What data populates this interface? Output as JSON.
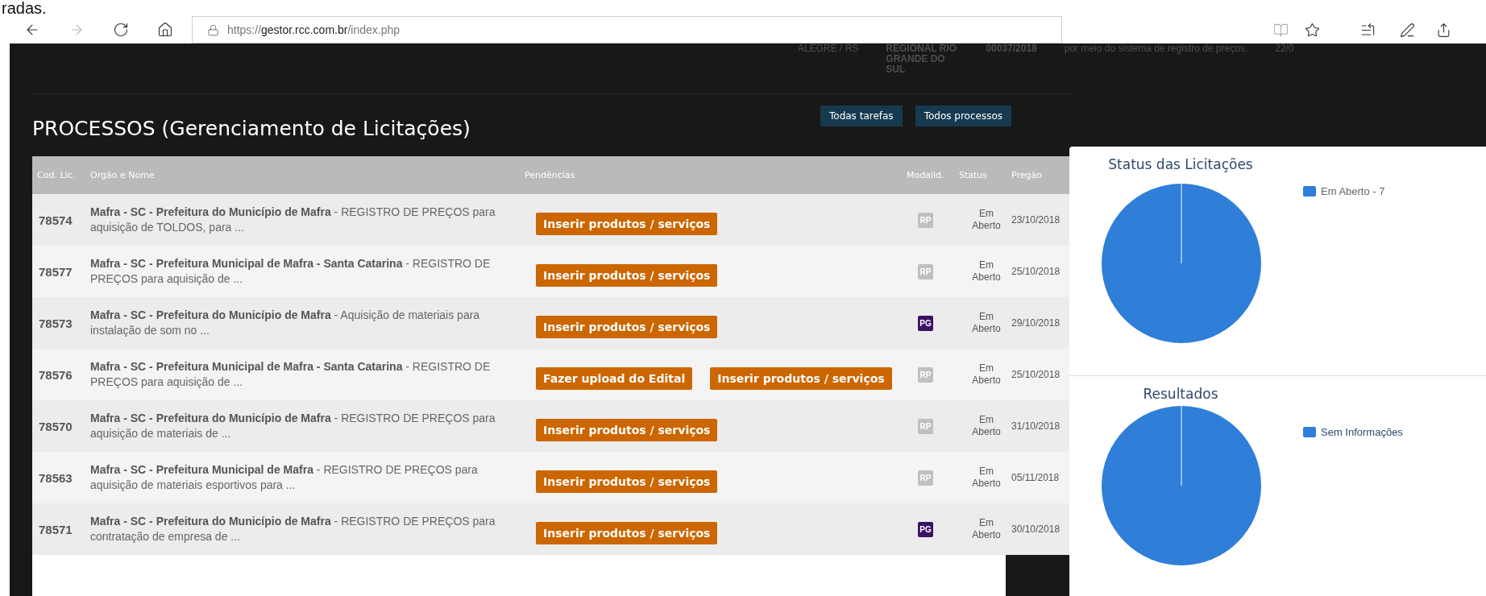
{
  "background_text": "radas.",
  "browser": {
    "nav": [
      {
        "kind": "back",
        "disabled": false
      },
      {
        "kind": "forward",
        "disabled": true
      },
      {
        "kind": "refresh",
        "disabled": false
      },
      {
        "kind": "home",
        "disabled": false
      }
    ],
    "url": {
      "scheme": "https://",
      "host": "gestor.rcc.com.br",
      "path": "/index.php"
    }
  },
  "faded_row": [
    "ALEGRE / RS",
    "REGIONAL RIO GRANDE DO SUL",
    "00037/2018",
    "por meio do sistema de registro de preços.",
    "22/0"
  ],
  "title": "PROCESSOS (Gerenciamento de Licitações)",
  "header_buttons": [
    "Todas tarefas",
    "Todos processos"
  ],
  "table": {
    "columns": [
      "Cod. Lic.",
      "Orgão e Nome",
      "Pendências",
      "Modalid.",
      "Status",
      "Pregão"
    ],
    "rows": [
      {
        "code": "78574",
        "name": "**Mafra - SC - Prefeitura do Município de Mafra** - REGISTRO DE PREÇOS para aquisição de TOLDOS, para ...",
        "pending": [
          "Inserir produtos / serviços"
        ],
        "modality": {
          "label": "RP",
          "color": "#c0c0c0"
        },
        "status": "Em Aberto",
        "date": "23/10/2018"
      },
      {
        "code": "78577",
        "name": "**Mafra - SC - Prefeitura Municipal de Mafra - Santa Catarina** - REGISTRO DE PREÇOS para aquisição de ...",
        "pending": [
          "Inserir produtos / serviços"
        ],
        "modality": {
          "label": "RP",
          "color": "#c0c0c0"
        },
        "status": "Em Aberto",
        "date": "25/10/2018"
      },
      {
        "code": "78573",
        "name": "**Mafra - SC - Prefeitura do Município de Mafra** - Aquisição de materiais para instalação de som no ...",
        "pending": [
          "Inserir produtos / serviços"
        ],
        "modality": {
          "label": "PG",
          "color": "#3b1363"
        },
        "status": "Em Aberto",
        "date": "29/10/2018"
      },
      {
        "code": "78576",
        "name": "**Mafra - SC - Prefeitura Municipal de Mafra - Santa Catarina** - REGISTRO DE PREÇOS para aquisição de ...",
        "pending": [
          "Fazer upload do Edital",
          "Inserir produtos / serviços"
        ],
        "modality": {
          "label": "RP",
          "color": "#c0c0c0"
        },
        "status": "Em Aberto",
        "date": "25/10/2018"
      },
      {
        "code": "78570",
        "name": "**Mafra - SC - Prefeitura do Município de Mafra** - REGISTRO DE PREÇOS para aquisição de materiais de ...",
        "pending": [
          "Inserir produtos / serviços"
        ],
        "modality": {
          "label": "RP",
          "color": "#c0c0c0"
        },
        "status": "Em Aberto",
        "date": "31/10/2018"
      },
      {
        "code": "78563",
        "name": "**Mafra - SC - Prefeitura Municipal de Mafra** - REGISTRO DE PREÇOS para aquisição de materiais esportivos para ...",
        "pending": [
          "Inserir produtos / serviços"
        ],
        "modality": {
          "label": "RP",
          "color": "#c0c0c0"
        },
        "status": "Em Aberto",
        "date": "05/11/2018"
      },
      {
        "code": "78571",
        "name": "**Mafra - SC - Prefeitura do Município de Mafra** - REGISTRO DE PREÇOS para contratação de empresa de ...",
        "pending": [
          "Inserir produtos / serviços"
        ],
        "modality": {
          "label": "PG",
          "color": "#3b1363"
        },
        "status": "Em Aberto",
        "date": "30/10/2018"
      }
    ]
  },
  "charts": [
    {
      "title": "Status das Licitações",
      "legend": [
        {
          "label": "Em Aberto - 7",
          "color": "#2f7ed8"
        }
      ]
    },
    {
      "title": "Resultados",
      "legend": [
        {
          "label": "Sem Informações",
          "color": "#2f7ed8"
        }
      ]
    }
  ]
}
